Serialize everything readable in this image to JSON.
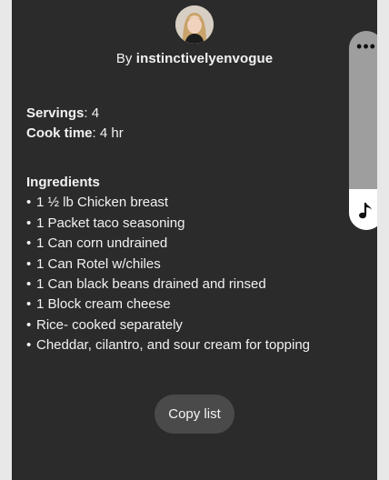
{
  "author": {
    "prefix": "By ",
    "handle": "instinctivelyenvogue"
  },
  "recipe": {
    "servings_label": "Servings",
    "servings_value": ": 4",
    "cook_time_label": "Cook time",
    "cook_time_value": ": 4 hr"
  },
  "ingredients": {
    "heading": "Ingredients",
    "items": [
      "1 ½ lb Chicken breast",
      "1 Packet taco seasoning",
      "1 Can corn undrained",
      "1 Can Rotel w/chiles",
      "1 Can black beans drained and rinsed",
      "1 Block cream cheese",
      "Rice- cooked separately",
      "Cheddar, cilantro, and sour cream for topping"
    ]
  },
  "actions": {
    "copy_label": "Copy list",
    "more_label": "•••"
  },
  "icons": {
    "more": "more-horizontal-icon",
    "music": "music-note-icon"
  },
  "colors": {
    "card_background": "#2b2b2b",
    "text": "#f2f2f2",
    "button_background": "#4a4a4a",
    "side_panel": "#9e9e9e"
  }
}
